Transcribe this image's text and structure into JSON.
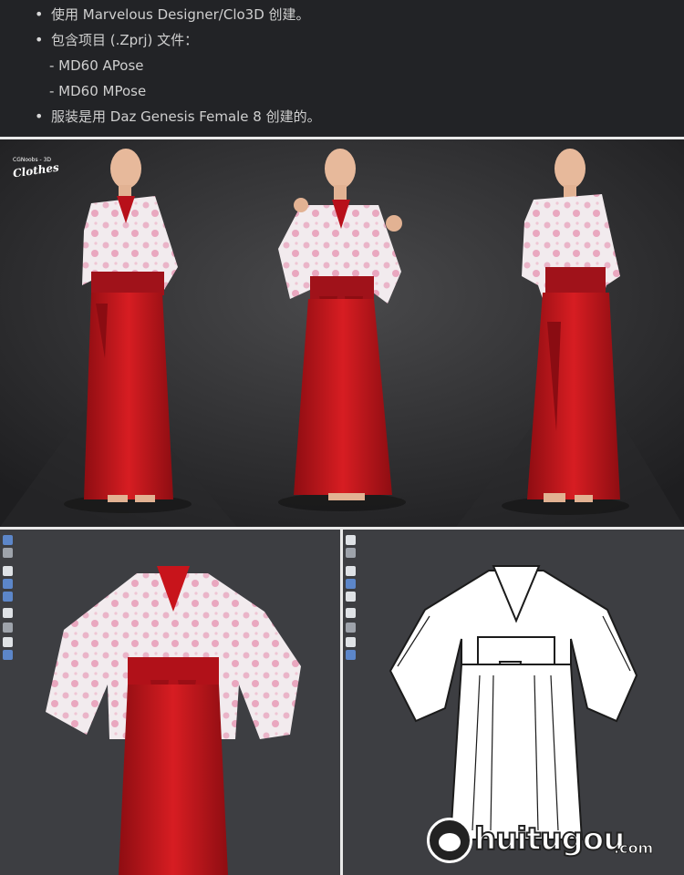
{
  "features": {
    "item1": "使用 Marvelous Designer/Clo3D 创建。",
    "item2": "包含项目 (.Zprj) 文件：",
    "sub1": "- MD60 APose",
    "sub2": "- MD60 MPose",
    "item3": "服装是用 Daz Genesis Female 8 创建的。"
  },
  "render": {
    "logo_small": "CGNoobs - 3D",
    "logo_big": "Clothes"
  },
  "colors": {
    "hakama_red": "#c8141b",
    "kimono_white": "#f3ecee",
    "sakura_pink": "#eab4c8",
    "viewport_bg": "#3d3e42"
  },
  "watermark": {
    "text": "huitugou",
    "domain": ".com"
  }
}
